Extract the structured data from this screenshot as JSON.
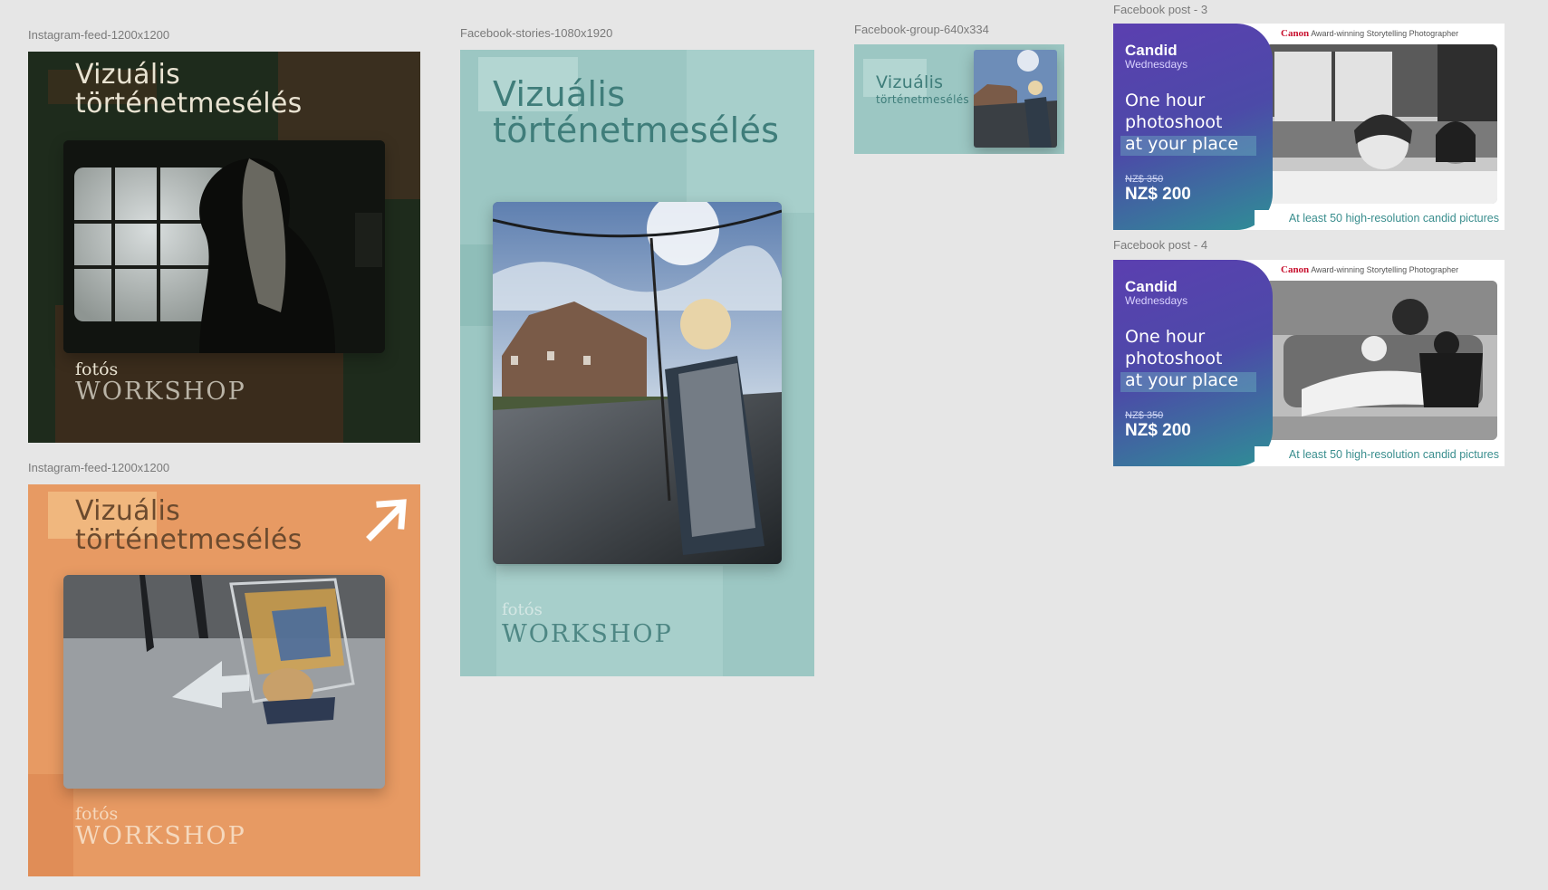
{
  "frames": {
    "ig1": {
      "label": "Instagram-feed-1200x1200",
      "title_line1": "Vizuális",
      "title_line2": "történetmesélés",
      "foto": "fotós",
      "workshop": "WORKSHOP"
    },
    "ig2": {
      "label": "Instagram-feed-1200x1200",
      "title_line1": "Vizuális",
      "title_line2": "történetmesélés",
      "foto": "fotós",
      "workshop": "WORKSHOP"
    },
    "stories": {
      "label": "Facebook-stories-1080x1920",
      "title_line1": "Vizuális",
      "title_line2": "történetmesélés",
      "foto": "fotós",
      "workshop": "WORKSHOP"
    },
    "group": {
      "label": "Facebook-group-640x334",
      "title_line1": "Vizuális",
      "title_line2": "történetmesélés"
    },
    "post3": {
      "label": "Facebook post - 3"
    },
    "post4": {
      "label": "Facebook post - 4"
    }
  },
  "ad": {
    "brand": "Canon",
    "tagline": "Award-winning Storytelling Photographer",
    "name": "Candid",
    "day": "Wednesdays",
    "line1": "One hour",
    "line2": "photoshoot",
    "line3": "at your place",
    "old_price": "NZ$ 350",
    "new_price": "NZ$ 200",
    "footer": "At least 50 high-resolution candid pictures"
  },
  "colors": {
    "canvas": "#e6e6e6",
    "ig1_bg": "#1e2b1c",
    "ig2_bg": "#e79a63",
    "teal_bg": "#9cc7c3",
    "ad_purple": "#5b3fb0",
    "ad_teal": "#2f8e96",
    "canon_red": "#c8102e"
  }
}
